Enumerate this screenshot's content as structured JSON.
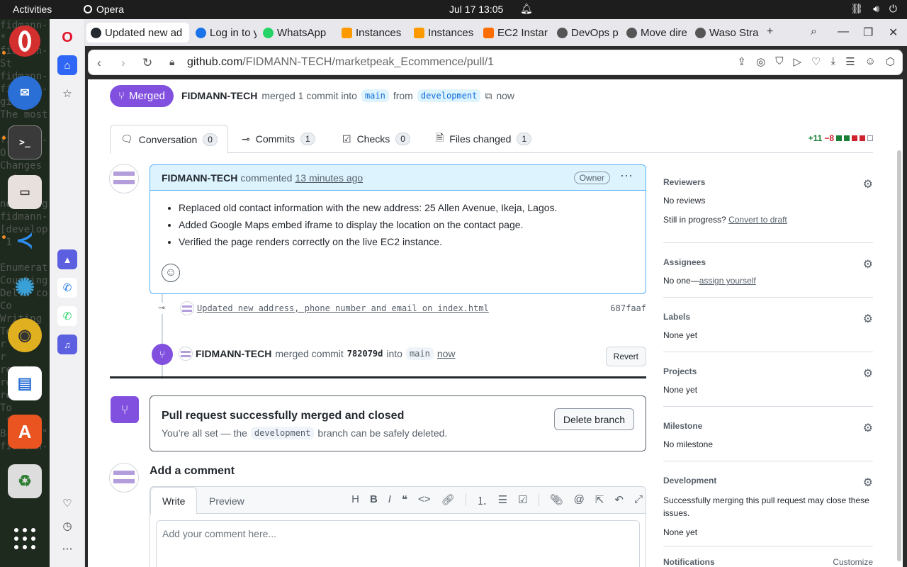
{
  "os": {
    "activities": "Activities",
    "app_name": "Opera",
    "clock": "Jul 17  13:05"
  },
  "browser": {
    "tabs": [
      {
        "label": "Updated new ad",
        "color": "#24292f",
        "active": true
      },
      {
        "label": "Log in to y",
        "color": "#1a73e8"
      },
      {
        "label": "WhatsApp",
        "color": "#25d366"
      },
      {
        "label": "Instances",
        "color": "#ff9900"
      },
      {
        "label": "Instances",
        "color": "#ff9900"
      },
      {
        "label": "EC2 Instar",
        "color": "#ff6d00"
      },
      {
        "label": "DevOps p",
        "color": "#555555"
      },
      {
        "label": "Move dire",
        "color": "#555555"
      },
      {
        "label": "Waso Stra",
        "color": "#555555"
      }
    ],
    "url_host": "github.com",
    "url_path": "/FIDMANN-TECH/marketpeak_Ecommence/pull/1"
  },
  "pr": {
    "status": "Merged",
    "author": "FIDMANN-TECH",
    "merged_text": "merged 1 commit into",
    "base": "main",
    "from_text": "from",
    "head": "development",
    "time": "now",
    "tabs": [
      {
        "label": "Conversation",
        "count": "0"
      },
      {
        "label": "Commits",
        "count": "1"
      },
      {
        "label": "Checks",
        "count": "0"
      },
      {
        "label": "Files changed",
        "count": "1"
      }
    ],
    "additions": "+11",
    "deletions": "−8"
  },
  "comment": {
    "author": "FIDMANN-TECH",
    "verb": "commented",
    "time": "13 minutes ago",
    "badge": "Owner",
    "items": [
      "Replaced old contact information with the new address: 25 Allen Avenue, Ikeja, Lagos.",
      "Added Google Maps embed iframe to display the location on the contact page.",
      "Verified the page renders correctly on the live EC2 instance."
    ]
  },
  "commit": {
    "message": "Updated new address, phone number and email on index.html",
    "sha": "687faaf"
  },
  "merge_event": {
    "author": "FIDMANN-TECH",
    "verb": "merged commit",
    "sha": "782079d",
    "into": "into",
    "branch": "main",
    "time": "now",
    "revert": "Revert"
  },
  "merged_box": {
    "title": "Pull request successfully merged and closed",
    "sub_before": "You’re all set — the",
    "branch": "development",
    "sub_after": "branch can be safely deleted.",
    "delete_btn": "Delete branch"
  },
  "add_comment": {
    "title": "Add a comment",
    "write": "Write",
    "preview": "Preview",
    "placeholder": "Add your comment here..."
  },
  "sidebar": {
    "reviewers_h": "Reviewers",
    "reviewers_v": "No reviews",
    "draft_pre": "Still in progress?",
    "draft_link": "Convert to draft",
    "assignees_h": "Assignees",
    "assignees_pre": "No one—",
    "assignees_link": "assign yourself",
    "labels_h": "Labels",
    "labels_v": "None yet",
    "projects_h": "Projects",
    "projects_v": "None yet",
    "milestone_h": "Milestone",
    "milestone_v": "No milestone",
    "development_h": "Development",
    "development_v": "Successfully merging this pull request may close these issues.",
    "development_v2": "None yet",
    "notifications_h": "Notifications",
    "customize": "Customize"
  },
  "colors": {
    "merged": "#8250df",
    "add": "#1a7f37",
    "del": "#cf222e"
  }
}
